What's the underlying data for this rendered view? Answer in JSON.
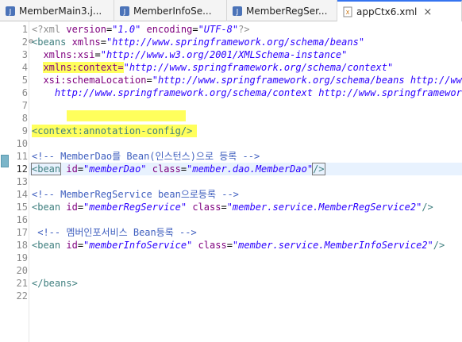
{
  "tabs": [
    {
      "label": "MemberMain3.j...",
      "icon": "java-file-icon",
      "active": false
    },
    {
      "label": "MemberInfoSe...",
      "icon": "java-file-icon",
      "active": false
    },
    {
      "label": "MemberRegSer...",
      "icon": "java-file-icon",
      "active": false
    },
    {
      "label": "appCtx6.xml",
      "icon": "xml-file-icon",
      "active": true,
      "close": "×"
    }
  ],
  "lines": [
    {
      "n": "1",
      "t1": "<?xml ",
      "t2": "version",
      "t3": "=",
      "t4": "\"1.0\"",
      "t5": " encoding",
      "t6": "=",
      "t7": "\"UTF-8\"",
      "t8": "?>"
    },
    {
      "n": "2",
      "fold": "⊖",
      "t1": "<beans",
      "t2": " xmlns",
      "t3": "=",
      "t4": "\"http://www.springframework.org/schema/beans\""
    },
    {
      "n": "3",
      "t1": "  xmlns:xsi",
      "t2": "=",
      "t3": "\"http://www.w3.org/2001/XMLSchema-instance\""
    },
    {
      "n": "4",
      "t1": "xmlns:context=",
      "t2": "\"http://www.springframework.org/schema/context\""
    },
    {
      "n": "5",
      "t1": "  xsi:schemaLocation",
      "t2": "=",
      "t3": "\"http://www.springframework.org/schema/beans http://www"
    },
    {
      "n": "6",
      "t1": "    http://www.springframework.org/schema/context http://www.springframework"
    },
    {
      "n": "7"
    },
    {
      "n": "8"
    },
    {
      "n": "9",
      "t1": "<context:annotation-config/>"
    },
    {
      "n": "10"
    },
    {
      "n": "11",
      "t1": "<!-- MemberDao를 Bean(인스턴스)으로 등록 -->"
    },
    {
      "n": "12",
      "t1": "<bean",
      "t2": " id",
      "t3": "=",
      "t4": "\"memberDao\"",
      "t5": " class",
      "t6": "=",
      "t7": "\"member.dao.MemberDao\"",
      "t8": "/>"
    },
    {
      "n": "13"
    },
    {
      "n": "14",
      "t1": "<!-- MemberRegService bean으로등록 -->"
    },
    {
      "n": "15",
      "t1": "<bean",
      "t2": " id",
      "t3": "=",
      "t4": "\"memberRegService\"",
      "t5": " class",
      "t6": "=",
      "t7": "\"member.service.MemberRegService2\"",
      "t8": "/>"
    },
    {
      "n": "16"
    },
    {
      "n": "17",
      "t1": " <!-- 멤버인포서비스 Bean등록 -->"
    },
    {
      "n": "18",
      "t1": "<bean",
      "t2": " id",
      "t3": "=",
      "t4": "\"memberInfoService\"",
      "t5": " class",
      "t6": "=",
      "t7": "\"member.service.MemberInfoService2\"",
      "t8": "/>"
    },
    {
      "n": "19"
    },
    {
      "n": "20"
    },
    {
      "n": "21",
      "t1": "</beans>"
    },
    {
      "n": "22"
    }
  ],
  "colors": {
    "highlight": "#ffff5c",
    "tag": "#3f7f7f",
    "attribute": "#7f007f",
    "value": "#2a00ff",
    "comment": "#3f5fbf"
  }
}
